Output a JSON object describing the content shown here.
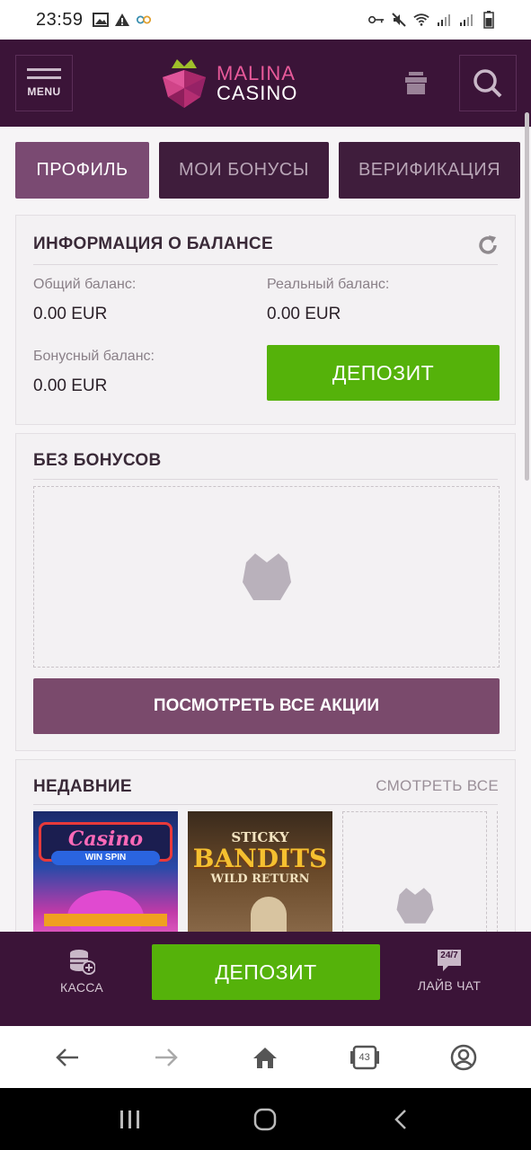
{
  "status_bar": {
    "time": "23:59"
  },
  "header": {
    "menu_label": "MENU",
    "logo_line1": "MALINA",
    "logo_line2": "CASINO"
  },
  "tabs": [
    {
      "label": "ПРОФИЛЬ",
      "active": true
    },
    {
      "label": "МОИ БОНУСЫ",
      "active": false
    },
    {
      "label": "ВЕРИФИКАЦИЯ",
      "active": false
    }
  ],
  "balance": {
    "title": "ИНФОРМАЦИЯ О БАЛАНСЕ",
    "total_label": "Общий баланс:",
    "total_value": "0.00 EUR",
    "real_label": "Реальный баланс:",
    "real_value": "0.00 EUR",
    "bonus_label": "Бонусный баланс:",
    "bonus_value": "0.00 EUR",
    "deposit_label": "ДЕПОЗИТ"
  },
  "bonuses": {
    "title": "БЕЗ БОНУСОВ",
    "promo_button": "ПОСМОТРЕТЬ ВСЕ АКЦИИ"
  },
  "recent": {
    "title": "НЕДАВНИЕ",
    "see_all": "СМОТРЕТЬ ВСЕ",
    "games": [
      {
        "line1": "Casino",
        "line2": "WIN SPIN"
      },
      {
        "line1": "STICKY",
        "line2": "BANDITS",
        "line3": "WILD RETURN"
      }
    ]
  },
  "bottom_bar": {
    "cashier_label": "КАССА",
    "deposit_label": "ДЕПОЗИТ",
    "chat_label": "ЛАЙВ ЧАТ",
    "chat_icon_text": "24/7"
  },
  "browser_nav": {
    "tabs_count": "43"
  },
  "colors": {
    "header_bg": "#3b1438",
    "accent_green": "#55b20a",
    "active_tab": "#7a4a72",
    "inactive_tab": "#3f1d3c",
    "logo_pink": "#e85a9a"
  }
}
